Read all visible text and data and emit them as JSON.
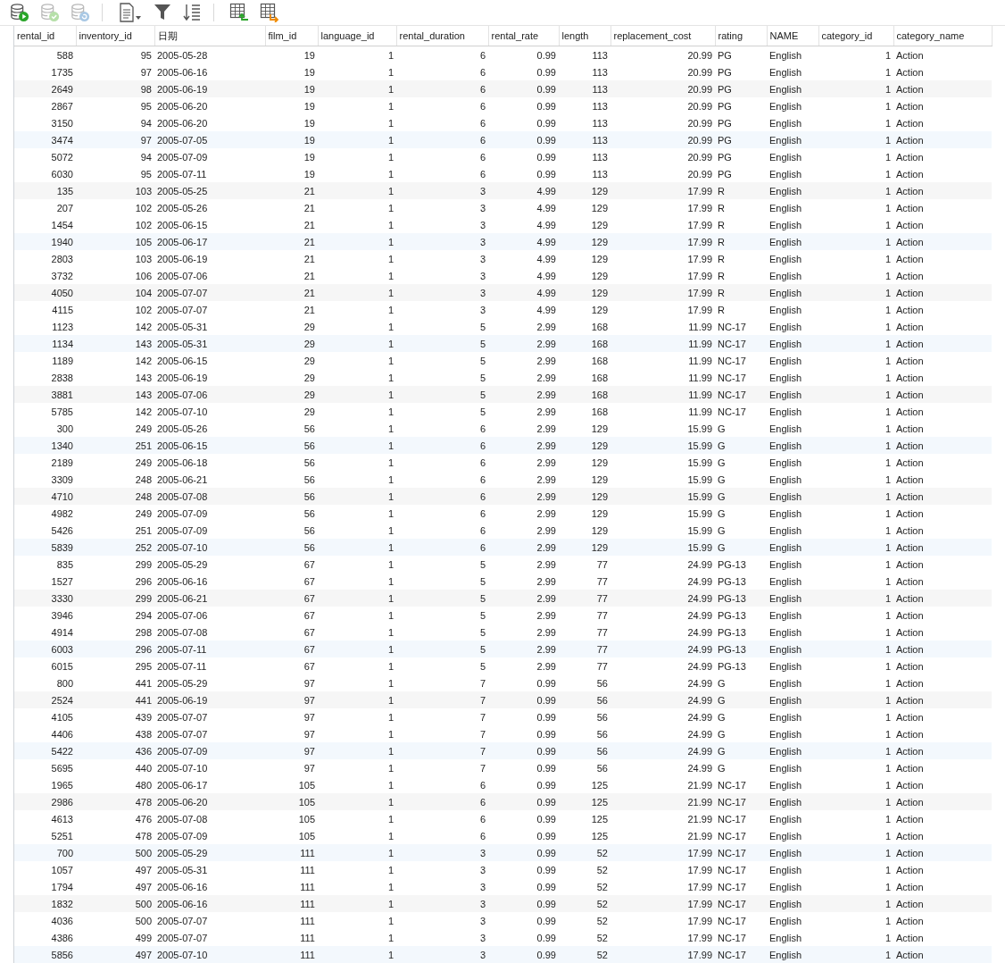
{
  "toolbar": {
    "groups": [
      [
        {
          "kind": "db-run",
          "disabled": false
        },
        {
          "kind": "db-check",
          "disabled": true
        },
        {
          "kind": "db-refresh",
          "disabled": true
        }
      ],
      [
        {
          "kind": "document-menu",
          "disabled": false
        },
        {
          "kind": "filter",
          "disabled": false
        },
        {
          "kind": "sort",
          "disabled": false
        }
      ],
      [
        {
          "kind": "table-import",
          "disabled": false
        },
        {
          "kind": "table-export",
          "disabled": false
        }
      ]
    ]
  },
  "table": {
    "columns": [
      "rental_id",
      "inventory_id",
      "日期",
      "film_id",
      "language_id",
      "rental_duration",
      "rental_rate",
      "length",
      "replacement_cost",
      "rating",
      "NAME",
      "category_id",
      "category_name"
    ],
    "rows": [
      [
        "588",
        "95",
        "2005-05-28",
        "19",
        "1",
        "6",
        "0.99",
        "113",
        "20.99",
        "PG",
        "English",
        "1",
        "Action"
      ],
      [
        "1735",
        "97",
        "2005-06-16",
        "19",
        "1",
        "6",
        "0.99",
        "113",
        "20.99",
        "PG",
        "English",
        "1",
        "Action"
      ],
      [
        "2649",
        "98",
        "2005-06-19",
        "19",
        "1",
        "6",
        "0.99",
        "113",
        "20.99",
        "PG",
        "English",
        "1",
        "Action"
      ],
      [
        "2867",
        "95",
        "2005-06-20",
        "19",
        "1",
        "6",
        "0.99",
        "113",
        "20.99",
        "PG",
        "English",
        "1",
        "Action"
      ],
      [
        "3150",
        "94",
        "2005-06-20",
        "19",
        "1",
        "6",
        "0.99",
        "113",
        "20.99",
        "PG",
        "English",
        "1",
        "Action"
      ],
      [
        "3474",
        "97",
        "2005-07-05",
        "19",
        "1",
        "6",
        "0.99",
        "113",
        "20.99",
        "PG",
        "English",
        "1",
        "Action"
      ],
      [
        "5072",
        "94",
        "2005-07-09",
        "19",
        "1",
        "6",
        "0.99",
        "113",
        "20.99",
        "PG",
        "English",
        "1",
        "Action"
      ],
      [
        "6030",
        "95",
        "2005-07-11",
        "19",
        "1",
        "6",
        "0.99",
        "113",
        "20.99",
        "PG",
        "English",
        "1",
        "Action"
      ],
      [
        "135",
        "103",
        "2005-05-25",
        "21",
        "1",
        "3",
        "4.99",
        "129",
        "17.99",
        "R",
        "English",
        "1",
        "Action"
      ],
      [
        "207",
        "102",
        "2005-05-26",
        "21",
        "1",
        "3",
        "4.99",
        "129",
        "17.99",
        "R",
        "English",
        "1",
        "Action"
      ],
      [
        "1454",
        "102",
        "2005-06-15",
        "21",
        "1",
        "3",
        "4.99",
        "129",
        "17.99",
        "R",
        "English",
        "1",
        "Action"
      ],
      [
        "1940",
        "105",
        "2005-06-17",
        "21",
        "1",
        "3",
        "4.99",
        "129",
        "17.99",
        "R",
        "English",
        "1",
        "Action"
      ],
      [
        "2803",
        "103",
        "2005-06-19",
        "21",
        "1",
        "3",
        "4.99",
        "129",
        "17.99",
        "R",
        "English",
        "1",
        "Action"
      ],
      [
        "3732",
        "106",
        "2005-07-06",
        "21",
        "1",
        "3",
        "4.99",
        "129",
        "17.99",
        "R",
        "English",
        "1",
        "Action"
      ],
      [
        "4050",
        "104",
        "2005-07-07",
        "21",
        "1",
        "3",
        "4.99",
        "129",
        "17.99",
        "R",
        "English",
        "1",
        "Action"
      ],
      [
        "4115",
        "102",
        "2005-07-07",
        "21",
        "1",
        "3",
        "4.99",
        "129",
        "17.99",
        "R",
        "English",
        "1",
        "Action"
      ],
      [
        "1123",
        "142",
        "2005-05-31",
        "29",
        "1",
        "5",
        "2.99",
        "168",
        "11.99",
        "NC-17",
        "English",
        "1",
        "Action"
      ],
      [
        "1134",
        "143",
        "2005-05-31",
        "29",
        "1",
        "5",
        "2.99",
        "168",
        "11.99",
        "NC-17",
        "English",
        "1",
        "Action"
      ],
      [
        "1189",
        "142",
        "2005-06-15",
        "29",
        "1",
        "5",
        "2.99",
        "168",
        "11.99",
        "NC-17",
        "English",
        "1",
        "Action"
      ],
      [
        "2838",
        "143",
        "2005-06-19",
        "29",
        "1",
        "5",
        "2.99",
        "168",
        "11.99",
        "NC-17",
        "English",
        "1",
        "Action"
      ],
      [
        "3881",
        "143",
        "2005-07-06",
        "29",
        "1",
        "5",
        "2.99",
        "168",
        "11.99",
        "NC-17",
        "English",
        "1",
        "Action"
      ],
      [
        "5785",
        "142",
        "2005-07-10",
        "29",
        "1",
        "5",
        "2.99",
        "168",
        "11.99",
        "NC-17",
        "English",
        "1",
        "Action"
      ],
      [
        "300",
        "249",
        "2005-05-26",
        "56",
        "1",
        "6",
        "2.99",
        "129",
        "15.99",
        "G",
        "English",
        "1",
        "Action"
      ],
      [
        "1340",
        "251",
        "2005-06-15",
        "56",
        "1",
        "6",
        "2.99",
        "129",
        "15.99",
        "G",
        "English",
        "1",
        "Action"
      ],
      [
        "2189",
        "249",
        "2005-06-18",
        "56",
        "1",
        "6",
        "2.99",
        "129",
        "15.99",
        "G",
        "English",
        "1",
        "Action"
      ],
      [
        "3309",
        "248",
        "2005-06-21",
        "56",
        "1",
        "6",
        "2.99",
        "129",
        "15.99",
        "G",
        "English",
        "1",
        "Action"
      ],
      [
        "4710",
        "248",
        "2005-07-08",
        "56",
        "1",
        "6",
        "2.99",
        "129",
        "15.99",
        "G",
        "English",
        "1",
        "Action"
      ],
      [
        "4982",
        "249",
        "2005-07-09",
        "56",
        "1",
        "6",
        "2.99",
        "129",
        "15.99",
        "G",
        "English",
        "1",
        "Action"
      ],
      [
        "5426",
        "251",
        "2005-07-09",
        "56",
        "1",
        "6",
        "2.99",
        "129",
        "15.99",
        "G",
        "English",
        "1",
        "Action"
      ],
      [
        "5839",
        "252",
        "2005-07-10",
        "56",
        "1",
        "6",
        "2.99",
        "129",
        "15.99",
        "G",
        "English",
        "1",
        "Action"
      ],
      [
        "835",
        "299",
        "2005-05-29",
        "67",
        "1",
        "5",
        "2.99",
        "77",
        "24.99",
        "PG-13",
        "English",
        "1",
        "Action"
      ],
      [
        "1527",
        "296",
        "2005-06-16",
        "67",
        "1",
        "5",
        "2.99",
        "77",
        "24.99",
        "PG-13",
        "English",
        "1",
        "Action"
      ],
      [
        "3330",
        "299",
        "2005-06-21",
        "67",
        "1",
        "5",
        "2.99",
        "77",
        "24.99",
        "PG-13",
        "English",
        "1",
        "Action"
      ],
      [
        "3946",
        "294",
        "2005-07-06",
        "67",
        "1",
        "5",
        "2.99",
        "77",
        "24.99",
        "PG-13",
        "English",
        "1",
        "Action"
      ],
      [
        "4914",
        "298",
        "2005-07-08",
        "67",
        "1",
        "5",
        "2.99",
        "77",
        "24.99",
        "PG-13",
        "English",
        "1",
        "Action"
      ],
      [
        "6003",
        "296",
        "2005-07-11",
        "67",
        "1",
        "5",
        "2.99",
        "77",
        "24.99",
        "PG-13",
        "English",
        "1",
        "Action"
      ],
      [
        "6015",
        "295",
        "2005-07-11",
        "67",
        "1",
        "5",
        "2.99",
        "77",
        "24.99",
        "PG-13",
        "English",
        "1",
        "Action"
      ],
      [
        "800",
        "441",
        "2005-05-29",
        "97",
        "1",
        "7",
        "0.99",
        "56",
        "24.99",
        "G",
        "English",
        "1",
        "Action"
      ],
      [
        "2524",
        "441",
        "2005-06-19",
        "97",
        "1",
        "7",
        "0.99",
        "56",
        "24.99",
        "G",
        "English",
        "1",
        "Action"
      ],
      [
        "4105",
        "439",
        "2005-07-07",
        "97",
        "1",
        "7",
        "0.99",
        "56",
        "24.99",
        "G",
        "English",
        "1",
        "Action"
      ],
      [
        "4406",
        "438",
        "2005-07-07",
        "97",
        "1",
        "7",
        "0.99",
        "56",
        "24.99",
        "G",
        "English",
        "1",
        "Action"
      ],
      [
        "5422",
        "436",
        "2005-07-09",
        "97",
        "1",
        "7",
        "0.99",
        "56",
        "24.99",
        "G",
        "English",
        "1",
        "Action"
      ],
      [
        "5695",
        "440",
        "2005-07-10",
        "97",
        "1",
        "7",
        "0.99",
        "56",
        "24.99",
        "G",
        "English",
        "1",
        "Action"
      ],
      [
        "1965",
        "480",
        "2005-06-17",
        "105",
        "1",
        "6",
        "0.99",
        "125",
        "21.99",
        "NC-17",
        "English",
        "1",
        "Action"
      ],
      [
        "2986",
        "478",
        "2005-06-20",
        "105",
        "1",
        "6",
        "0.99",
        "125",
        "21.99",
        "NC-17",
        "English",
        "1",
        "Action"
      ],
      [
        "4613",
        "476",
        "2005-07-08",
        "105",
        "1",
        "6",
        "0.99",
        "125",
        "21.99",
        "NC-17",
        "English",
        "1",
        "Action"
      ],
      [
        "5251",
        "478",
        "2005-07-09",
        "105",
        "1",
        "6",
        "0.99",
        "125",
        "21.99",
        "NC-17",
        "English",
        "1",
        "Action"
      ],
      [
        "700",
        "500",
        "2005-05-29",
        "111",
        "1",
        "3",
        "0.99",
        "52",
        "17.99",
        "NC-17",
        "English",
        "1",
        "Action"
      ],
      [
        "1057",
        "497",
        "2005-05-31",
        "111",
        "1",
        "3",
        "0.99",
        "52",
        "17.99",
        "NC-17",
        "English",
        "1",
        "Action"
      ],
      [
        "1794",
        "497",
        "2005-06-16",
        "111",
        "1",
        "3",
        "0.99",
        "52",
        "17.99",
        "NC-17",
        "English",
        "1",
        "Action"
      ],
      [
        "1832",
        "500",
        "2005-06-16",
        "111",
        "1",
        "3",
        "0.99",
        "52",
        "17.99",
        "NC-17",
        "English",
        "1",
        "Action"
      ],
      [
        "4036",
        "500",
        "2005-07-07",
        "111",
        "1",
        "3",
        "0.99",
        "52",
        "17.99",
        "NC-17",
        "English",
        "1",
        "Action"
      ],
      [
        "4386",
        "499",
        "2005-07-07",
        "111",
        "1",
        "3",
        "0.99",
        "52",
        "17.99",
        "NC-17",
        "English",
        "1",
        "Action"
      ],
      [
        "5856",
        "497",
        "2005-07-10",
        "111",
        "1",
        "3",
        "0.99",
        "52",
        "17.99",
        "NC-17",
        "English",
        "1",
        "Action"
      ]
    ]
  }
}
